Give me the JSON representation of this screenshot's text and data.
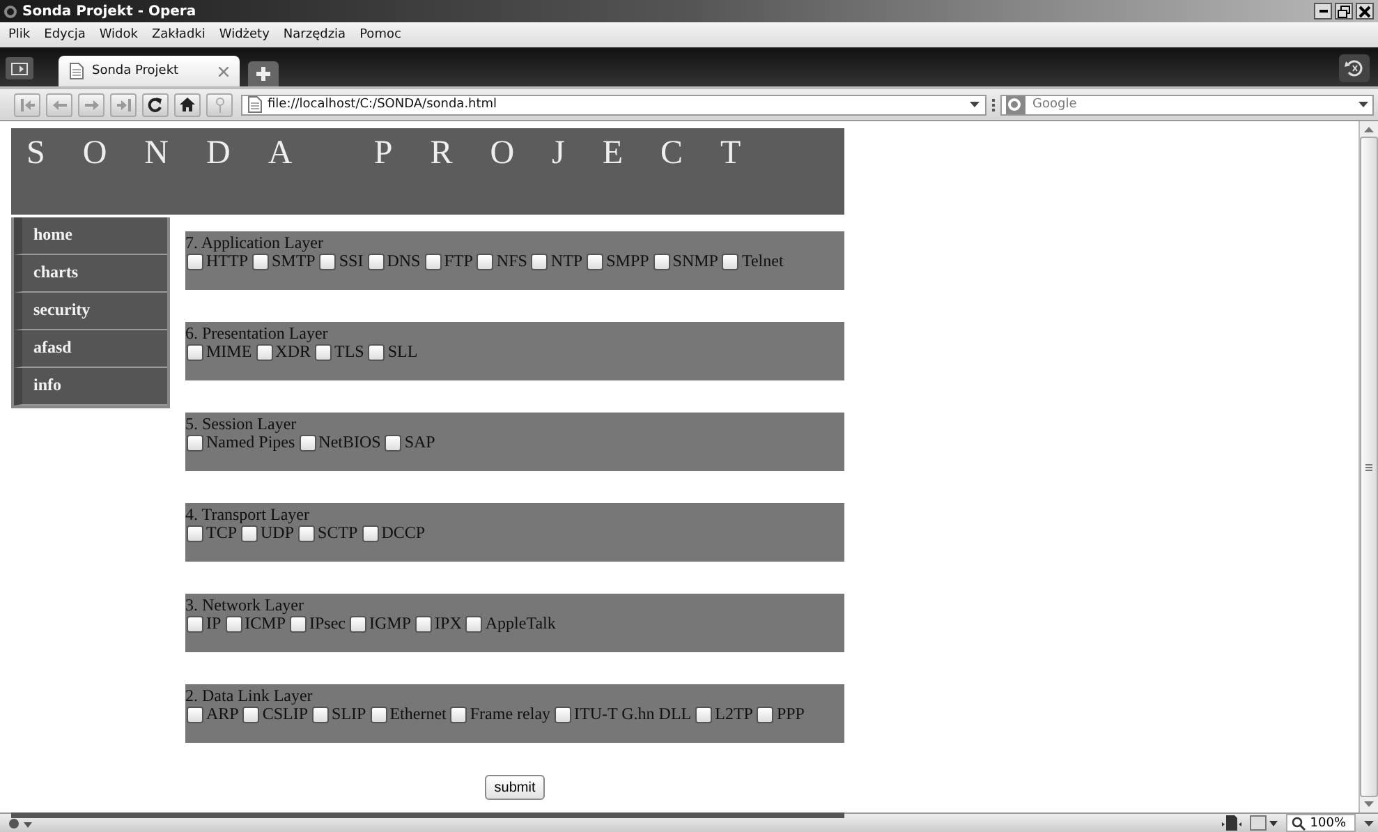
{
  "window": {
    "title": "Sonda Projekt - Opera"
  },
  "menu": [
    "Plik",
    "Edycja",
    "Widok",
    "Zakładki",
    "Widżety",
    "Narzędzia",
    "Pomoc"
  ],
  "tabs": [
    {
      "label": "Sonda Projekt",
      "selected": true
    }
  ],
  "address": {
    "value": "file://localhost/C:/SONDA/sonda.html"
  },
  "search": {
    "placeholder": "Google"
  },
  "page": {
    "heading": "SONDA PROJECT",
    "nav": [
      {
        "label": "home"
      },
      {
        "label": "charts"
      },
      {
        "label": "security"
      },
      {
        "label": "afasd"
      },
      {
        "label": "info"
      }
    ],
    "layers": [
      {
        "title": "7. Application Layer",
        "options": [
          {
            "label": "HTTP",
            "checked": false
          },
          {
            "label": "SMTP",
            "checked": false
          },
          {
            "label": "SSI",
            "checked": false
          },
          {
            "label": "DNS",
            "checked": false
          },
          {
            "label": "FTP",
            "checked": false
          },
          {
            "label": "NFS",
            "checked": false
          },
          {
            "label": "NTP",
            "checked": false
          },
          {
            "label": "SMPP",
            "checked": false
          },
          {
            "label": "SNMP",
            "checked": false
          },
          {
            "label": "Telnet",
            "checked": false
          }
        ]
      },
      {
        "title": "6. Presentation Layer",
        "options": [
          {
            "label": "MIME",
            "checked": false
          },
          {
            "label": "XDR",
            "checked": false
          },
          {
            "label": "TLS",
            "checked": false
          },
          {
            "label": "SLL",
            "checked": false
          }
        ]
      },
      {
        "title": "5. Session Layer",
        "options": [
          {
            "label": "Named Pipes",
            "checked": false
          },
          {
            "label": "NetBIOS",
            "checked": false
          },
          {
            "label": "SAP",
            "checked": false
          }
        ]
      },
      {
        "title": "4. Transport Layer",
        "options": [
          {
            "label": "TCP",
            "checked": false
          },
          {
            "label": "UDP",
            "checked": false
          },
          {
            "label": "SCTP",
            "checked": false
          },
          {
            "label": "DCCP",
            "checked": false
          }
        ]
      },
      {
        "title": "3. Network Layer",
        "options": [
          {
            "label": "IP",
            "checked": false
          },
          {
            "label": "ICMP",
            "checked": false
          },
          {
            "label": "IPsec",
            "checked": false
          },
          {
            "label": "IGMP",
            "checked": false
          },
          {
            "label": "IPX",
            "checked": false
          },
          {
            "label": "AppleTalk",
            "checked": false
          }
        ]
      },
      {
        "title": "2. Data Link Layer",
        "options": [
          {
            "label": "ARP",
            "checked": false
          },
          {
            "label": "CSLIP",
            "checked": false
          },
          {
            "label": "SLIP",
            "checked": false
          },
          {
            "label": "Ethernet",
            "checked": false
          },
          {
            "label": "Frame relay",
            "checked": false
          },
          {
            "label": "ITU-T G.hn DLL",
            "checked": false
          },
          {
            "label": "L2TP",
            "checked": false
          },
          {
            "label": "PPP",
            "checked": false
          }
        ]
      }
    ],
    "submit": "submit"
  },
  "status_bar": {
    "zoom": "100%"
  }
}
